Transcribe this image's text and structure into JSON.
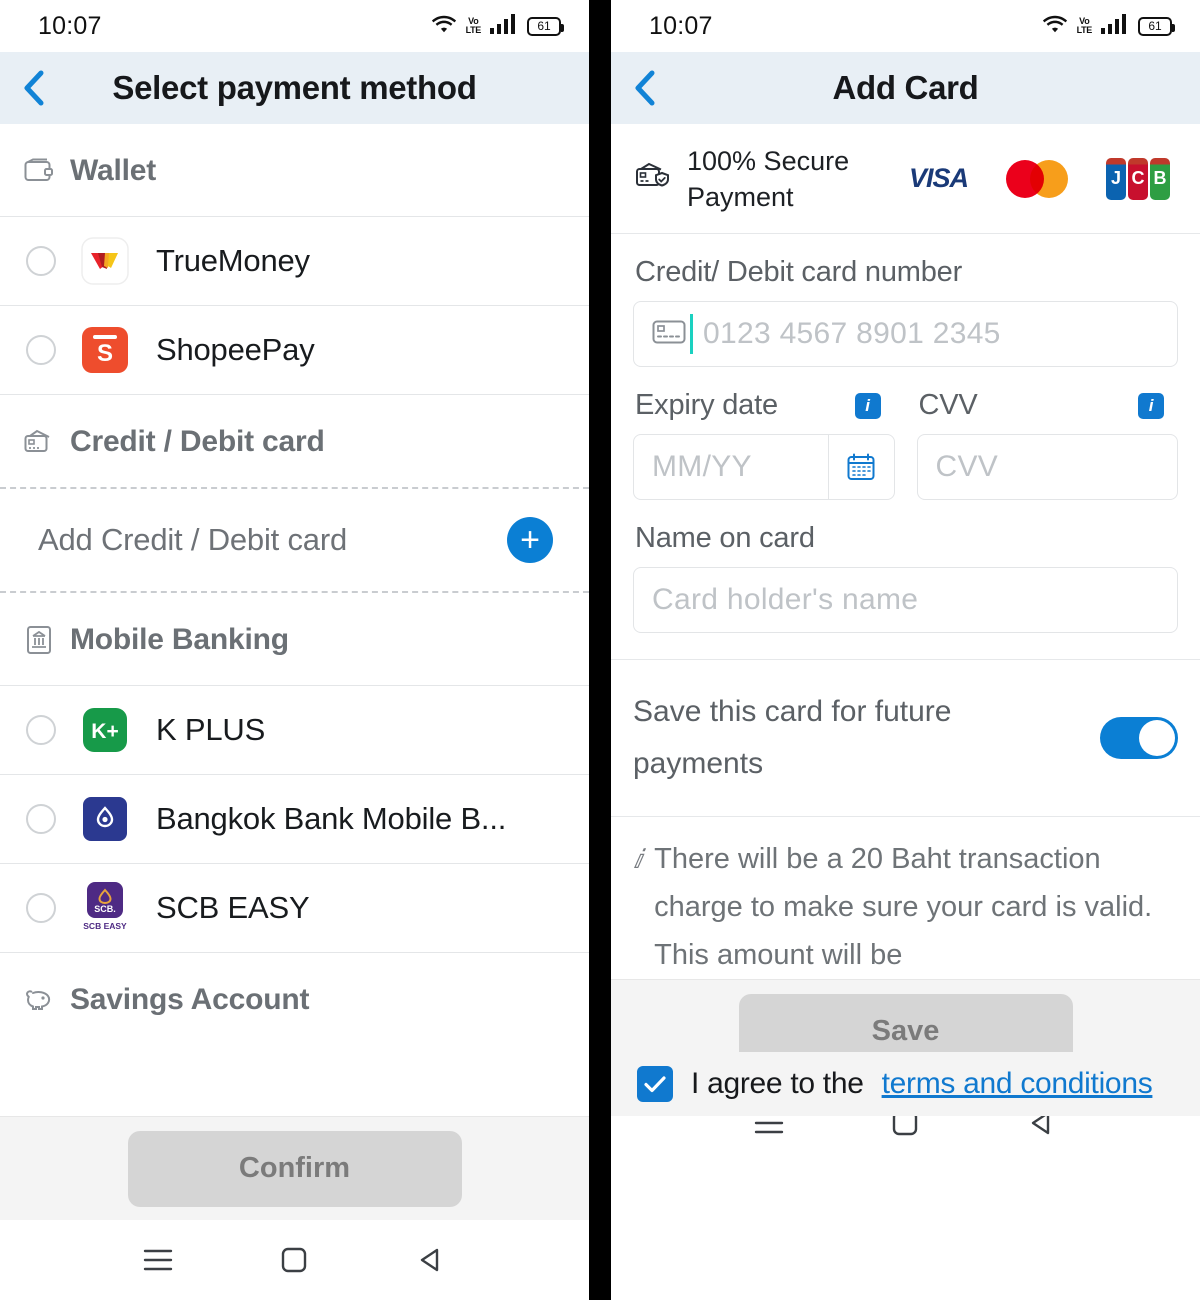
{
  "status_bar": {
    "time": "10:07",
    "wifi_icon": "wifi-icon",
    "volte_top": "Vo",
    "volte_bottom": "LTE",
    "signal_icon": "signal-bars-icon",
    "battery_level": "61"
  },
  "left_screen": {
    "title": "Select payment method",
    "back_icon": "chevron-left-icon",
    "sections": [
      {
        "icon": "wallet-icon",
        "label": "Wallet"
      },
      {
        "icon": "credit-card-icon",
        "label": "Credit / Debit card"
      },
      {
        "icon": "bank-icon",
        "label": "Mobile Banking"
      },
      {
        "icon": "piggy-bank-icon",
        "label": "Savings Account"
      }
    ],
    "wallet_methods": [
      {
        "label": "TrueMoney",
        "logo": "truemoney-logo",
        "selected": false
      },
      {
        "label": "ShopeePay",
        "logo": "shopeepay-logo",
        "selected": false
      }
    ],
    "add_card": {
      "label": "Add Credit / Debit card",
      "plus_icon": "plus-icon"
    },
    "bank_methods": [
      {
        "label": "K PLUS",
        "logo": "kplus-logo",
        "selected": false
      },
      {
        "label": "Bangkok Bank Mobile B...",
        "logo": "bangkok-bank-logo",
        "selected": false
      },
      {
        "label": "SCB EASY",
        "logo": "scb-easy-logo",
        "selected": false
      }
    ],
    "confirm_label": "Confirm"
  },
  "right_screen": {
    "title": "Add Card",
    "back_icon": "chevron-left-icon",
    "secure": {
      "icon": "secure-card-icon",
      "text": "100% Secure Payment",
      "brands": [
        {
          "name": "visa-logo",
          "label": "VISA"
        },
        {
          "name": "mastercard-logo",
          "label": ""
        },
        {
          "name": "jcb-logo",
          "j": "J",
          "c": "C",
          "b": "B"
        }
      ]
    },
    "card_number": {
      "label": "Credit/ Debit card number",
      "placeholder": "0123 4567 8901 2345",
      "value": "",
      "icon": "card-chip-icon",
      "focused": true
    },
    "expiry": {
      "label": "Expiry date",
      "placeholder": "MM/YY",
      "value": "",
      "info_icon": "info-badge-icon",
      "calendar_icon": "calendar-icon"
    },
    "cvv": {
      "label": "CVV",
      "placeholder": "CVV",
      "value": "",
      "info_icon": "info-badge-icon"
    },
    "name_on_card": {
      "label": "Name on card",
      "placeholder": "Card holder's name",
      "value": ""
    },
    "save_card": {
      "label": "Save this card for future payments",
      "toggle_on": true
    },
    "note": {
      "icon": "info-italic-icon",
      "text": "There will be a 20 Baht transaction charge to make sure your card is valid. This amount will be"
    },
    "terms": {
      "checkbox_checked": true,
      "check_icon": "checkmark-icon",
      "text": "I agree to the ",
      "link_text": "terms and conditions"
    },
    "save_label": "Save"
  },
  "nav_bar": {
    "menu_icon": "hamburger-menu-icon",
    "home_icon": "home-square-icon",
    "back_icon": "back-triangle-icon"
  },
  "colors": {
    "accent_blue": "#0b7fd4",
    "link_blue": "#1079cf",
    "title_bar_bg": "#e8eff5",
    "caret_teal": "#1ad1c0"
  }
}
